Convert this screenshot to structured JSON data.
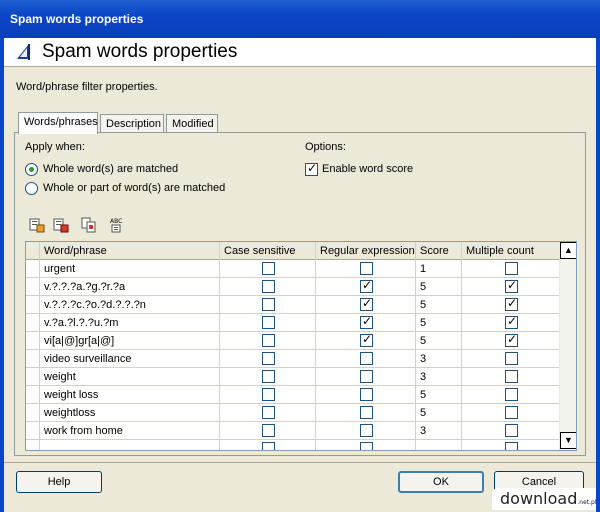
{
  "window": {
    "title": "Spam words properties"
  },
  "header": {
    "title": "Spam words properties",
    "icon": "flag-icon"
  },
  "description": "Word/phrase filter properties.",
  "tabs": [
    {
      "label": "Words/phrases",
      "active": true
    },
    {
      "label": "Description",
      "active": false
    },
    {
      "label": "Modified",
      "active": false
    }
  ],
  "apply_when": {
    "label": "Apply when:",
    "options": [
      {
        "label": "Whole word(s) are matched",
        "checked": true
      },
      {
        "label": "Whole or part of word(s) are matched",
        "checked": false
      }
    ]
  },
  "options": {
    "label": "Options:",
    "enable_word_score": {
      "label": "Enable word score",
      "checked": true
    }
  },
  "toolbar": {
    "icons": [
      "add-icon",
      "remove-icon",
      "copy-icon",
      "spellcheck-icon"
    ],
    "spell_label": "ABC"
  },
  "table": {
    "columns": [
      "Word/phrase",
      "Case sensitive",
      "Regular expression",
      "Score",
      "Multiple count"
    ],
    "rows": [
      {
        "word": "urgent",
        "case": false,
        "regex": false,
        "score": "1",
        "multi": false
      },
      {
        "word": "v.?.?.?a.?g.?r.?a",
        "case": false,
        "regex": true,
        "score": "5",
        "multi": true
      },
      {
        "word": "v.?.?.?c.?o.?d.?.?.?n",
        "case": false,
        "regex": true,
        "score": "5",
        "multi": true
      },
      {
        "word": "v.?a.?l.?.?u.?m",
        "case": false,
        "regex": true,
        "score": "5",
        "multi": true
      },
      {
        "word": "vi[a|@]gr[a|@]",
        "case": false,
        "regex": true,
        "score": "5",
        "multi": true
      },
      {
        "word": "video surveillance",
        "case": false,
        "regex": false,
        "score": "3",
        "multi": false
      },
      {
        "word": "weight",
        "case": false,
        "regex": false,
        "score": "3",
        "multi": false
      },
      {
        "word": "weight loss",
        "case": false,
        "regex": false,
        "score": "5",
        "multi": false
      },
      {
        "word": "weightloss",
        "case": false,
        "regex": false,
        "score": "5",
        "multi": false
      },
      {
        "word": "work from home",
        "case": false,
        "regex": false,
        "score": "3",
        "multi": false
      },
      {
        "word": "",
        "case": false,
        "regex": false,
        "score": "",
        "multi": false
      }
    ],
    "scroll_up": "▲",
    "scroll_down": "▼"
  },
  "buttons": {
    "help": "Help",
    "ok": "OK",
    "cancel": "Cancel"
  },
  "watermark": {
    "text": "download",
    "suffix": ".net.pl"
  },
  "colors": {
    "titlebar": "#0a46c8",
    "frame": "#ece9d8",
    "radio_dot": "#21a121"
  }
}
